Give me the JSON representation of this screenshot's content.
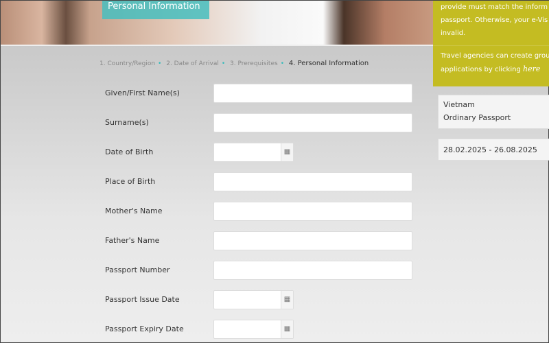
{
  "banner": {
    "title": "Personal Information"
  },
  "notice": {
    "line1": "provide must match the inform",
    "line2": "passport. Otherwise, your e-Vis",
    "line3": "invalid.",
    "agency1": "Travel agencies can create grou",
    "agency2": "applications by clicking ",
    "here_link": "here"
  },
  "steps": [
    {
      "label": "1. Country/Region"
    },
    {
      "label": "2. Date of Arrival"
    },
    {
      "label": "3. Prerequisites"
    },
    {
      "label": "4. Personal Information"
    }
  ],
  "fields": [
    {
      "label": "Given/First Name(s)",
      "value": "",
      "type": "text"
    },
    {
      "label": "Surname(s)",
      "value": "",
      "type": "text"
    },
    {
      "label": "Date of Birth",
      "value": "",
      "type": "date"
    },
    {
      "label": "Place of Birth",
      "value": "",
      "type": "text"
    },
    {
      "label": "Mother's Name",
      "value": "",
      "type": "text"
    },
    {
      "label": "Father's Name",
      "value": "",
      "type": "text"
    },
    {
      "label": "Passport Number",
      "value": "",
      "type": "text"
    },
    {
      "label": "Passport Issue Date",
      "value": "",
      "type": "date"
    },
    {
      "label": "Passport Expiry Date",
      "value": "",
      "type": "date"
    }
  ],
  "summary": {
    "country": "Vietnam",
    "document": "Ordinary Passport",
    "dates": "28.02.2025 - 26.08.2025"
  },
  "colors": {
    "accent": "#c4bc22",
    "teal": "#46bebe"
  }
}
